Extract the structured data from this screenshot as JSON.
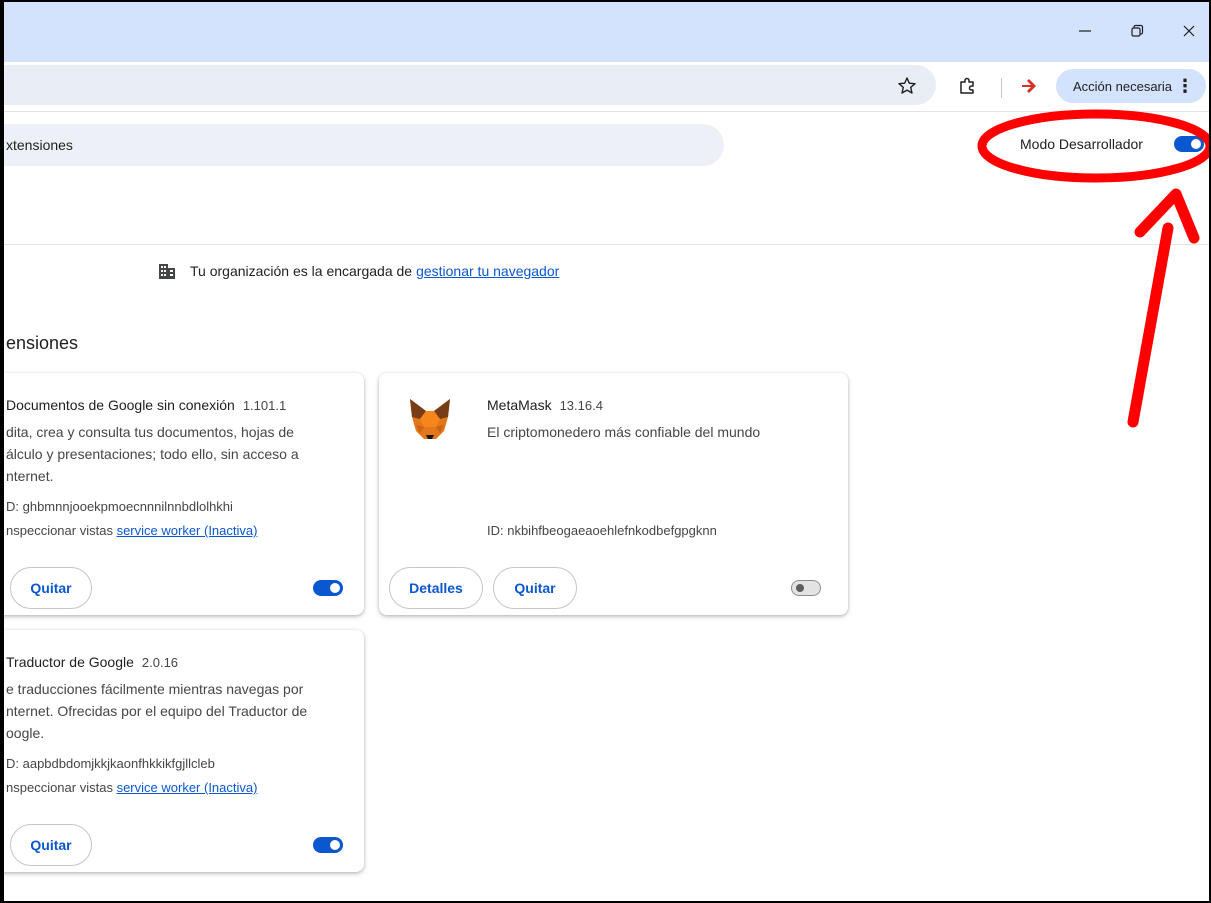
{
  "toolbar": {
    "action_label": "Acción necesaria"
  },
  "search": {
    "placeholder": "xtensiones"
  },
  "dev_mode": {
    "label": "Modo Desarrollador",
    "enabled": true
  },
  "org_notice": {
    "text": "Tu organización es la encargada de",
    "link": "gestionar tu navegador"
  },
  "section_title": "ensiones",
  "extensions": [
    {
      "name": "Documentos de Google sin conexión",
      "version": "1.101.1",
      "desc_lines": [
        "dita, crea y consulta tus documentos, hojas de",
        "álculo y presentaciones; todo ello, sin acceso a",
        "nternet."
      ],
      "id": "D: ghbmnnjooekpmoecnnnilnnbdlolhkhi",
      "inspect_label": "nspeccionar vistas",
      "inspect_link": "service worker (Inactiva)",
      "remove_label": "Quitar",
      "enabled": true
    },
    {
      "name": "MetaMask",
      "version": "13.16.4",
      "desc_lines": [
        "El criptomonedero más confiable del mundo"
      ],
      "id": "ID: nkbihfbeogaeaoehlefnkodbefgpgknn",
      "details_label": "Detalles",
      "remove_label": "Quitar",
      "enabled": false
    },
    {
      "name": "Traductor de Google",
      "version": "2.0.16",
      "desc_lines": [
        "e traducciones fácilmente mientras navegas por",
        "nternet. Ofrecidas por el equipo del Traductor de",
        "oogle."
      ],
      "id": "D: aapbdbdomjkkjkaonfhkkikfgjllcleb",
      "inspect_label": "nspeccionar vistas",
      "inspect_link": "service worker (Inactiva)",
      "remove_label": "Quitar",
      "enabled": true
    }
  ],
  "colors": {
    "accent": "#0b57d0",
    "titlebar": "#d3e3fd",
    "annotation": "#ff0000"
  }
}
